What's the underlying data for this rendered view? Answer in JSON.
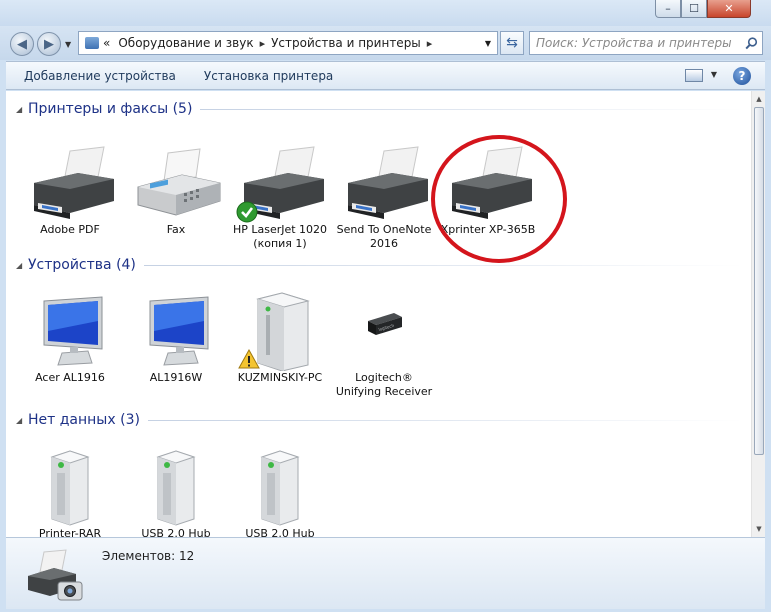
{
  "window": {
    "caption_min": "–",
    "caption_max": "☐",
    "caption_close": "✕"
  },
  "nav": {
    "back_icon": "back-arrow-icon",
    "forward_icon": "forward-arrow-icon",
    "breadcrumb_root": "«",
    "breadcrumbs": [
      "Оборудование и звук",
      "Устройства и принтеры"
    ],
    "search_placeholder": "Поиск: Устройства и принтеры"
  },
  "commands": {
    "add_device": "Добавление устройства",
    "add_printer": "Установка принтера",
    "help": "?"
  },
  "groups": [
    {
      "title": "Принтеры и факсы (5)",
      "items": [
        {
          "label": "Adobe PDF",
          "icon": "printer-icon"
        },
        {
          "label": "Fax",
          "icon": "fax-icon"
        },
        {
          "label": "HP LaserJet 1020 (копия 1)",
          "icon": "printer-icon",
          "badge": "default-check-icon"
        },
        {
          "label": "Send To OneNote 2016",
          "icon": "printer-icon"
        },
        {
          "label": "Xprinter XP-365B",
          "icon": "printer-icon",
          "highlighted": true
        }
      ]
    },
    {
      "title": "Устройства (4)",
      "items": [
        {
          "label": "Acer AL1916",
          "icon": "monitor-icon"
        },
        {
          "label": "AL1916W",
          "icon": "monitor-icon"
        },
        {
          "label": "KUZMINSKIY-PC",
          "icon": "computer-tower-icon",
          "badge": "warning-icon"
        },
        {
          "label": "Logitech® Unifying Receiver",
          "icon": "usb-receiver-icon"
        }
      ]
    },
    {
      "title": "Нет данных (3)",
      "items": [
        {
          "label": "Printer-RAR",
          "icon": "server-icon"
        },
        {
          "label": "USB 2.0 Hub",
          "icon": "server-icon"
        },
        {
          "label": "USB 2.0 Hub",
          "icon": "server-icon"
        }
      ]
    }
  ],
  "details": {
    "count_text": "Элементов: 12"
  },
  "colors": {
    "group_title": "#1e3287",
    "highlight_circle": "#d4151c"
  }
}
